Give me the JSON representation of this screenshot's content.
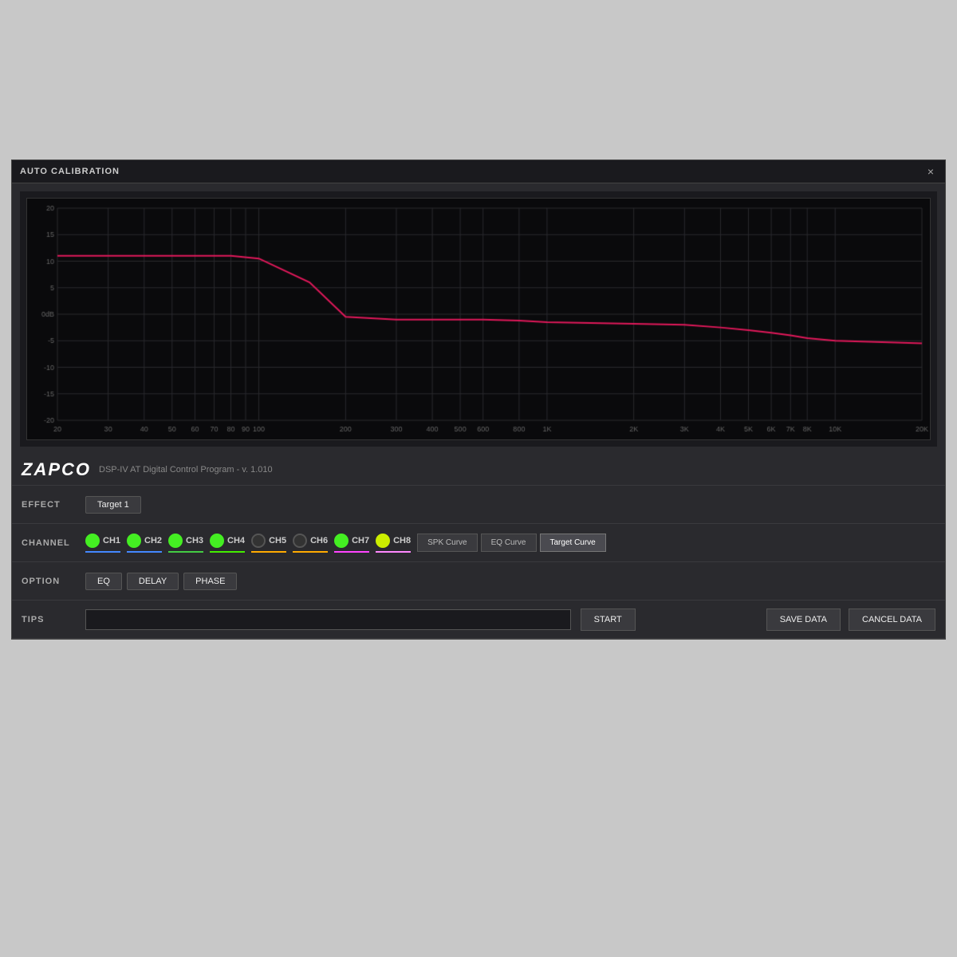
{
  "window": {
    "title": "AUTO CALIBRATION",
    "close_label": "×"
  },
  "brand": {
    "logo": "ZAPCO",
    "subtitle": "DSP-IV AT Digital Control Program - v. 1.010"
  },
  "effect": {
    "label": "EFFECT",
    "button": "Target 1"
  },
  "channel": {
    "label": "CHANNEL",
    "channels": [
      {
        "id": "CH1",
        "color": "#44ee22",
        "underline": "#4488ff",
        "active": true
      },
      {
        "id": "CH2",
        "color": "#44ee22",
        "underline": "#4488ff",
        "active": true
      },
      {
        "id": "CH3",
        "color": "#44ee22",
        "underline": "#44cc44",
        "active": true
      },
      {
        "id": "CH4",
        "color": "#44ee22",
        "underline": "#44ee00",
        "active": true
      },
      {
        "id": "CH5",
        "color": "#555",
        "underline": "#ffaa00",
        "active": false
      },
      {
        "id": "CH6",
        "color": "#555",
        "underline": "#ffaa00",
        "active": false
      },
      {
        "id": "CH7",
        "color": "#44ee22",
        "underline": "#ff44ff",
        "active": true
      },
      {
        "id": "CH8",
        "color": "#ccee00",
        "underline": "#ff88ff",
        "active": true
      }
    ],
    "curve_buttons": [
      {
        "label": "SPK Curve",
        "active": false
      },
      {
        "label": "EQ Curve",
        "active": false
      },
      {
        "label": "Target Curve",
        "active": true
      }
    ]
  },
  "option": {
    "label": "OPTION",
    "buttons": [
      "EQ",
      "DELAY",
      "PHASE"
    ]
  },
  "tips": {
    "label": "TIPS",
    "placeholder": "",
    "start_label": "START",
    "save_label": "SAVE DATA",
    "cancel_label": "CANCEL DATA"
  },
  "chart": {
    "y_labels": [
      "20",
      "15",
      "10",
      "5",
      "0dB",
      "-5",
      "-10",
      "-15",
      "-20"
    ],
    "x_labels": [
      "20",
      "30",
      "40",
      "50",
      "60",
      "70",
      "80",
      "90",
      "100",
      "200",
      "300",
      "400",
      "500",
      "600",
      "800",
      "1K",
      "2K",
      "3K",
      "4K",
      "5K",
      "6K",
      "7K",
      "8K",
      "10K",
      "20K"
    ],
    "accent_color": "#e0185a"
  }
}
